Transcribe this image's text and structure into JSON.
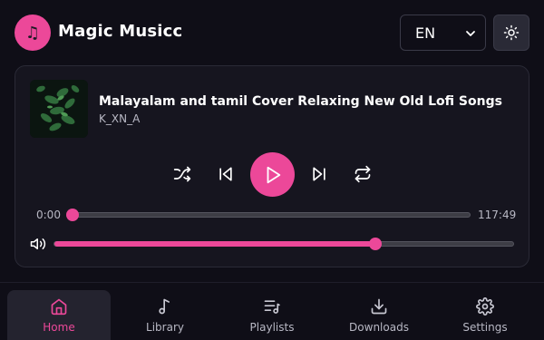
{
  "app": {
    "title": "Magic Musicc",
    "logo_icon": "music-note-icon"
  },
  "header": {
    "language": "EN",
    "theme_icon": "sun-icon"
  },
  "player": {
    "song_title": "Malayalam and tamil Cover Relaxing New Old Lofi Songs",
    "artist": "K_XN_A",
    "current_time": "0:00",
    "duration": "117:49",
    "progress_fraction": 0.0,
    "volume_fraction": 0.7
  },
  "controls": [
    "shuffle-icon",
    "previous-icon",
    "play-icon",
    "next-icon",
    "repeat-icon"
  ],
  "nav": {
    "items": [
      {
        "label": "Home",
        "icon": "home-icon",
        "active": true
      },
      {
        "label": "Library",
        "icon": "music-note-icon",
        "active": false
      },
      {
        "label": "Playlists",
        "icon": "playlist-icon",
        "active": false
      },
      {
        "label": "Downloads",
        "icon": "download-icon",
        "active": false
      },
      {
        "label": "Settings",
        "icon": "gear-icon",
        "active": false
      }
    ]
  },
  "colors": {
    "accent": "#ec4899",
    "background": "#0f0e17",
    "card": "#16151f"
  }
}
